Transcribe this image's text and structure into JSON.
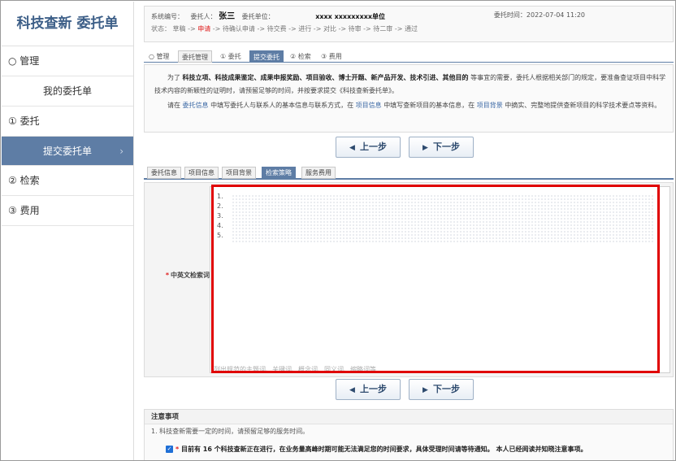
{
  "sidebar": {
    "title": "科技查新 委托单",
    "items": [
      {
        "label": "○ 管理",
        "type": "group"
      },
      {
        "label": "我的委托单",
        "type": "sub"
      },
      {
        "label": "① 委托",
        "type": "group"
      },
      {
        "label": "提交委托单",
        "type": "sub",
        "active": true,
        "chevron": "›"
      },
      {
        "label": "② 检索",
        "type": "group"
      },
      {
        "label": "③ 费用",
        "type": "group"
      }
    ]
  },
  "info": {
    "order_no_label": "系统编号：",
    "client_label": "委托人：",
    "client_name": "张三",
    "unit_label": "委托单位：",
    "unit_name": "xxxx xxxxxxxxx单位",
    "time_label": "委托时间：",
    "time_value": "2022-07-04 11:20",
    "status_label": "状态：",
    "status_before": "草稿 ->",
    "status_current": "申请",
    "status_after": "-> 待确认申请 -> 待交费 -> 进行 -> 对比 -> 待审 -> 待二审 -> 通过"
  },
  "top_tabs": [
    "○ 管理",
    "委托管理",
    "① 委托",
    "提交委托",
    "② 检索",
    "③ 费用"
  ],
  "description": {
    "p1_prefix": "为了",
    "p1_bold": "科技立项、科技成果鉴定、成果申报奖励、项目验收、博士开题、新产品开发、技术引进、其他目的",
    "p1_suffix": "等事宜的需要，委托人根据相关部门的规定，要准备查证项目中科学技术内容的新颖性的证明时，请预留足够的时间，并按要求提交《科技查新委托单》。",
    "p2_a": "请在",
    "p2_link1": "委托信息",
    "p2_b": "中填写委托人与联系人的基本信息与联系方式，在",
    "p2_link2": "项目信息",
    "p2_c": "中填写查新项目的基本信息，在",
    "p2_link3": "项目背景",
    "p2_d": "中摘实、完整地提供查新项目的科学技术要点等资料。"
  },
  "buttons": {
    "prev": "上一步",
    "next": "下一步",
    "prev_icon": "◀",
    "next_icon": "▶"
  },
  "form_tabs": [
    "委托信息",
    "项目信息",
    "项目背景",
    "检索策略",
    "服务费用"
  ],
  "form_tabs_active": 3,
  "field": {
    "required_mark": "*",
    "label": "中英文检索词",
    "lines": [
      "1.",
      "2.",
      "3.",
      "4.",
      "5."
    ],
    "placeholder": "列出规范的主题词、关键词、概念词、同义词、缩略词等"
  },
  "notice": {
    "title": "注意事项",
    "item1": "1. 科技查新需要一定的时间，请预留足够的服务时间。",
    "check_required": "*",
    "check_text": "目前有 16 个科技查新正在进行，在业务量高峰时期可能无法满足您的时间要求，具体受理时间请等待通知。 本人已经阅读并知晓注意事项。",
    "check_mark": "✓"
  },
  "colors": {
    "accent": "#5e7da5",
    "highlight_border": "#e00000",
    "title": "#3d5f88"
  }
}
